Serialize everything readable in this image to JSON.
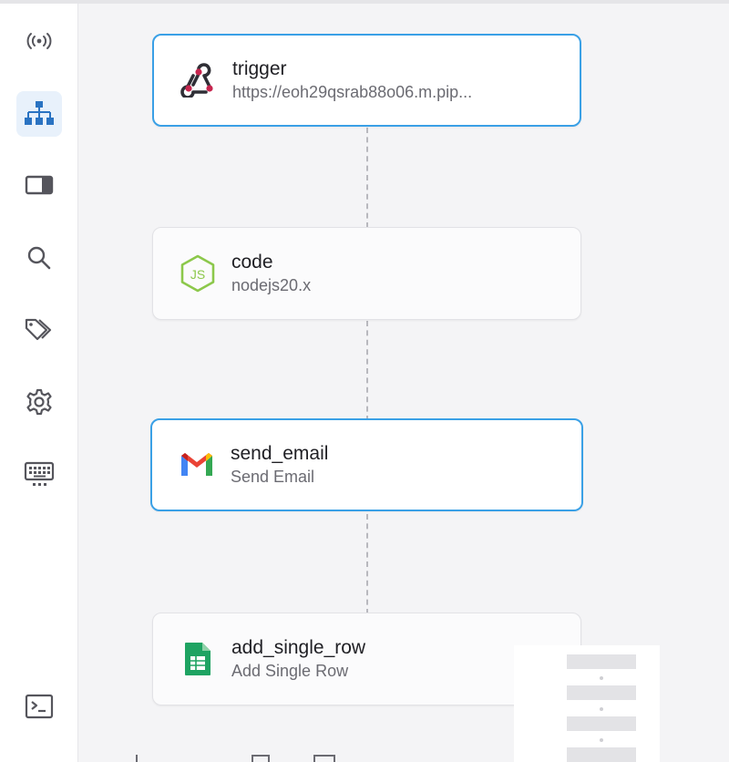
{
  "sidebar": {
    "items": [
      {
        "name": "broadcast-icon",
        "active": false
      },
      {
        "name": "workflow-icon",
        "active": true
      },
      {
        "name": "panel-icon",
        "active": false
      },
      {
        "name": "search-icon",
        "active": false
      },
      {
        "name": "tags-icon",
        "active": false
      },
      {
        "name": "gear-icon",
        "active": false
      },
      {
        "name": "keyboard-icon",
        "active": false
      },
      {
        "name": "terminal-icon",
        "active": false
      }
    ]
  },
  "nodes": [
    {
      "title": "trigger",
      "subtitle": "https://eoh29qsrab88o06.m.pip...",
      "icon": "webhook-icon",
      "selected": true
    },
    {
      "title": "code",
      "subtitle": "nodejs20.x",
      "icon": "nodejs-icon",
      "selected": false
    },
    {
      "title": "send_email",
      "subtitle": "Send Email",
      "icon": "gmail-icon",
      "selected": true
    },
    {
      "title": "add_single_row",
      "subtitle": "Add Single Row",
      "icon": "google-sheets-icon",
      "selected": false
    }
  ],
  "colors": {
    "accent": "#3aa0e6",
    "sidebar_active_bg": "#e8f1fb",
    "webhook": "#c7254e",
    "nodejs": "#8cc84b",
    "sheets": "#1ea362"
  }
}
